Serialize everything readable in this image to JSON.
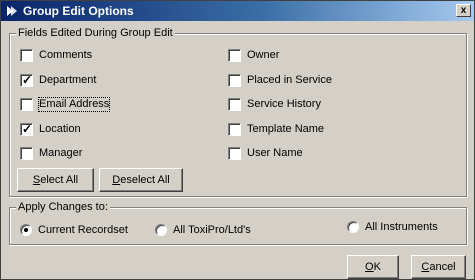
{
  "title": "Group Edit Options",
  "close_label": "x",
  "fields_group": {
    "legend": "Fields Edited During Group Edit",
    "left_column": [
      {
        "label": "Comments",
        "checked": false,
        "focused": false
      },
      {
        "label": "Department",
        "checked": true,
        "focused": false
      },
      {
        "label": "Email Address",
        "checked": false,
        "focused": true
      },
      {
        "label": "Location",
        "checked": true,
        "focused": false
      },
      {
        "label": "Manager",
        "checked": false,
        "focused": false
      }
    ],
    "right_column": [
      {
        "label": "Owner",
        "checked": false
      },
      {
        "label": "Placed in Service",
        "checked": false
      },
      {
        "label": "Service History",
        "checked": false
      },
      {
        "label": "Template Name",
        "checked": false
      },
      {
        "label": "User Name",
        "checked": false
      }
    ],
    "select_all": {
      "mnemonic": "S",
      "rest": "elect All"
    },
    "deselect_all": {
      "mnemonic": "D",
      "rest": "eselect All"
    }
  },
  "apply_group": {
    "legend": "Apply Changes to:",
    "options": [
      {
        "label": "Current Recordset",
        "selected": true
      },
      {
        "label": "All ToxiPro/Ltd's",
        "selected": false
      },
      {
        "label": "All Instruments",
        "selected": false
      }
    ]
  },
  "ok_button": {
    "mnemonic": "O",
    "rest": "K"
  },
  "cancel_button": {
    "mnemonic": "C",
    "rest": "ancel"
  }
}
